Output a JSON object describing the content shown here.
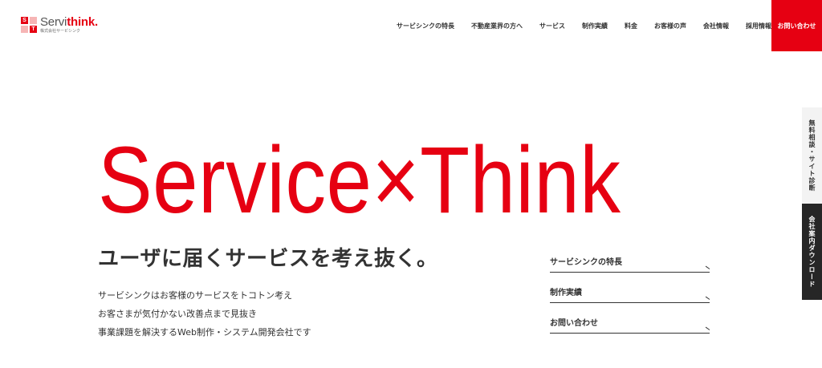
{
  "header": {
    "logo": {
      "mark_letters": [
        "S",
        "",
        "",
        "T"
      ],
      "name_plain": "Servi",
      "name_accent": "think",
      "name_dot": ".",
      "subtitle": "株式会社サービシンク"
    },
    "nav": [
      "サービシンクの特長",
      "不動産業界の方へ",
      "サービス",
      "制作実績",
      "料金",
      "お客様の声",
      "会社情報",
      "採用情報"
    ],
    "contact_label": "お問い合わせ"
  },
  "side_tabs": {
    "consult": "無料相談・サイト診断",
    "download": "会社案内ダウンロード"
  },
  "hero": {
    "title": "Service×Think",
    "subtitle": "ユーザに届くサービスを考え抜く。",
    "description": [
      "サービシンクはお客様のサービスをトコトン考え",
      "お客さまが気付かない改善点まで見抜き",
      "事業課題を解決するWeb制作・システム開発会社です"
    ],
    "links": [
      "サービシンクの特長",
      "制作実績",
      "お問い合わせ"
    ]
  },
  "colors": {
    "brand_red": "#e60012",
    "text_dark": "#333333",
    "dark_tab": "#262626"
  }
}
